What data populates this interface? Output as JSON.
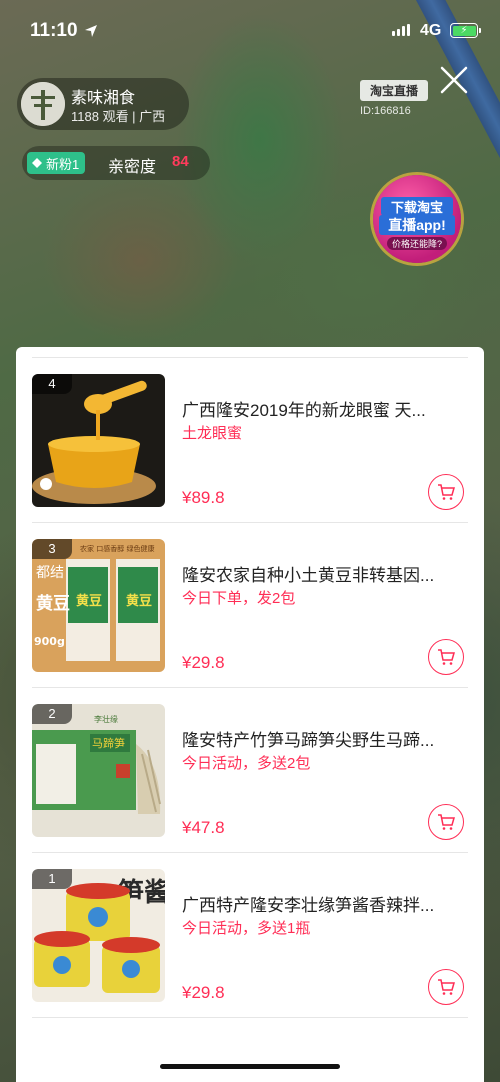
{
  "status_bar": {
    "time": "11:10",
    "network": "4G"
  },
  "anchor": {
    "name": "素味湘食",
    "meta": "1188 观看 | 广西"
  },
  "brand": {
    "logo": "淘宝直播",
    "room_id": "ID:166816"
  },
  "fan": {
    "badge": "新粉1",
    "intimacy_label": "亲密度",
    "intimacy_value": "84"
  },
  "promo": {
    "line1": "下载淘宝",
    "line2": "直播app!",
    "line3": "价格还能降?"
  },
  "products": [
    {
      "rank": "4",
      "title": "广西隆安2019年的新龙眼蜜 天...",
      "tag": "土龙眼蜜",
      "price": "¥89.8"
    },
    {
      "rank": "3",
      "title": "隆安农家自种小土黄豆非转基因...",
      "tag": "今日下单，发2包",
      "price": "¥29.8"
    },
    {
      "rank": "2",
      "title": "隆安特产竹笋马蹄笋尖野生马蹄...",
      "tag": "今日活动，多送2包",
      "price": "¥47.8"
    },
    {
      "rank": "1",
      "title": "广西特产隆安李壮缘笋酱香辣拌...",
      "tag": "今日活动，多送1瓶",
      "price": "¥29.8"
    }
  ],
  "thumb_labels": {
    "soy_side": "都结",
    "soy_main": "黄豆",
    "soy_weight": "900g",
    "soy_pack": "黄豆",
    "soy_top": "农家 口感香醇 绿色健康",
    "bamboo_pack": "马蹄笋",
    "bamboo_side": "李壮缘",
    "sauce_label": "笋酱"
  },
  "colors": {
    "accent": "#ff2d55",
    "fan_badge": "#2ec08a"
  }
}
